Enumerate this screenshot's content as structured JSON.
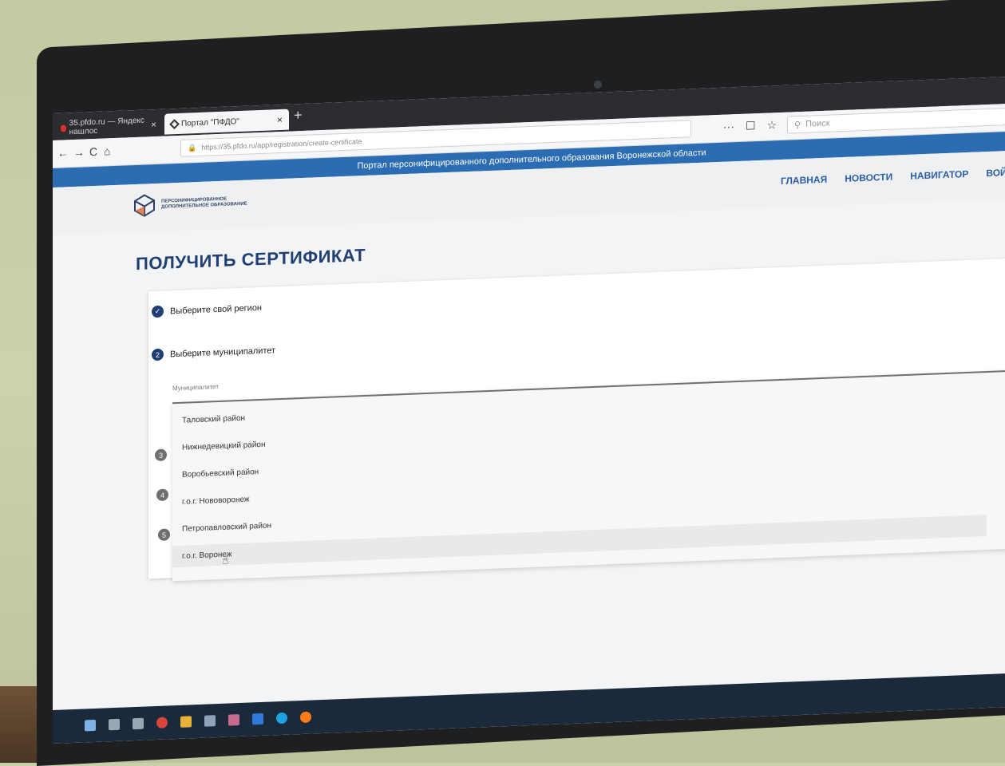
{
  "browser": {
    "tabs": [
      {
        "label": "35.pfdo.ru — Яндекс нашлос",
        "active": false
      },
      {
        "label": "Портал \"ПФДО\"",
        "active": true
      }
    ],
    "url": "https://35.pfdo.ru/app/registration/create-certificate",
    "search_placeholder": "Поиск",
    "nav": {
      "back": "←",
      "forward": "→",
      "reload": "C",
      "home": "⌂",
      "more": "···",
      "pocket": "☐",
      "star": "☆",
      "newtab": "+",
      "close": "×"
    }
  },
  "site": {
    "banner": "Портал персонифицированного дополнительного образования Воронежской области",
    "logo_text": "ПЕРСОНИФИЦИРОВАННОЕ ДОПОЛНИТЕЛЬНОЕ ОБРАЗОВАНИЕ",
    "menu": [
      "ГЛАВНАЯ",
      "НОВОСТИ",
      "НАВИГАТОР",
      "ВОЙТ"
    ]
  },
  "page": {
    "title": "ПОЛУЧИТЬ СЕРТИФИКАТ",
    "steps": [
      {
        "label": "Выберите свой регион",
        "state": "done",
        "marker": "✓"
      },
      {
        "label": "Выберите муниципалитет",
        "state": "current",
        "marker": "2"
      },
      {
        "marker": "3",
        "state": "pending"
      },
      {
        "marker": "4",
        "state": "pending"
      },
      {
        "marker": "5",
        "state": "pending"
      }
    ],
    "municipality_label": "Муниципалитет",
    "options": [
      "Таловский район",
      "Нижнедевицкий район",
      "Воробьевский район",
      "г.о.г. Нововоронеж",
      "Петропавловский район",
      "г.о.г. Воронеж"
    ]
  },
  "colors": {
    "accent": "#2b6cb3",
    "title": "#1f3e74",
    "tabbar": "#2b2d30"
  }
}
